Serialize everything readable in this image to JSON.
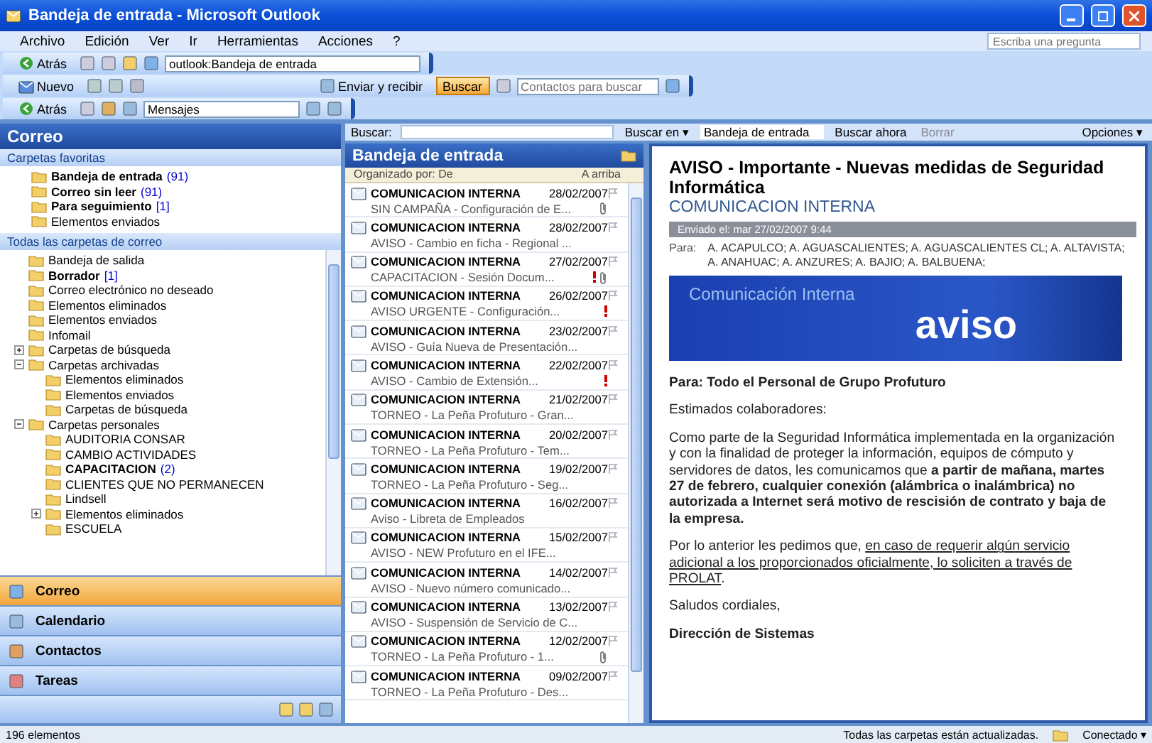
{
  "window": {
    "title": "Bandeja de entrada - Microsoft Outlook"
  },
  "menu": [
    "Archivo",
    "Edición",
    "Ver",
    "Ir",
    "Herramientas",
    "Acciones",
    "?"
  ],
  "help_box": {
    "placeholder": "Escriba una pregunta"
  },
  "toolbar1": {
    "back": "Atrás",
    "address": "outlook:Bandeja de entrada"
  },
  "toolbar2": {
    "new": "Nuevo",
    "send_receive": "Enviar y recibir",
    "find": {
      "label": "Buscar",
      "active": true
    },
    "contacts": {
      "placeholder": "Contactos para buscar"
    }
  },
  "toolbar3": {
    "back": "Atrás",
    "view": "Mensajes"
  },
  "nav": {
    "header": "Correo",
    "favorites_header": "Carpetas favoritas",
    "favorites": [
      {
        "label": "Bandeja de entrada",
        "count": "(91)",
        "unread": true
      },
      {
        "label": "Correo sin leer",
        "count": "(91)",
        "unread": true
      },
      {
        "label": "Para seguimiento",
        "count": "[1]",
        "unread": true
      },
      {
        "label": "Elementos enviados",
        "unread": false
      }
    ],
    "all_header": "Todas las carpetas de correo",
    "tree": [
      {
        "label": "Bandeja de salida",
        "unread": false
      },
      {
        "label": "Borrador",
        "count": "[1]",
        "unread": true
      },
      {
        "label": "Correo electrónico no deseado",
        "unread": false
      },
      {
        "label": "Elementos eliminados",
        "unread": false
      },
      {
        "label": "Elementos enviados",
        "unread": false
      },
      {
        "label": "Infomail",
        "unread": false
      },
      {
        "label": "Carpetas de búsqueda",
        "unread": false,
        "expanded": false
      },
      {
        "label": "Carpetas archivadas",
        "unread": false,
        "expanded": true,
        "children": [
          {
            "label": "Elementos eliminados",
            "unread": false
          },
          {
            "label": "Elementos enviados",
            "unread": false
          },
          {
            "label": "Carpetas de búsqueda",
            "unread": false
          }
        ]
      },
      {
        "label": "Carpetas personales",
        "unread": false,
        "expanded": true,
        "children": [
          {
            "label": "AUDITORIA CONSAR",
            "unread": false
          },
          {
            "label": "CAMBIO ACTIVIDADES",
            "unread": false
          },
          {
            "label": "CAPACITACION",
            "count": "(2)",
            "unread": true
          },
          {
            "label": "CLIENTES QUE NO PERMANECEN",
            "unread": false
          },
          {
            "label": "Lindsell",
            "unread": false
          },
          {
            "label": "Elementos eliminados",
            "unread": false,
            "expanded": false
          },
          {
            "label": "ESCUELA",
            "unread": false
          }
        ]
      }
    ],
    "buttons": [
      {
        "label": "Correo",
        "selected": true
      },
      {
        "label": "Calendario",
        "selected": false
      },
      {
        "label": "Contactos",
        "selected": false
      },
      {
        "label": "Tareas",
        "selected": false
      }
    ]
  },
  "search": {
    "label": "Buscar:",
    "scope_label": "Buscar en ▾",
    "scope": "Bandeja de entrada",
    "find_now": "Buscar ahora",
    "clear": "Borrar",
    "options": "Opciones ▾"
  },
  "list": {
    "title": "Bandeja de entrada",
    "sort": "Organizado por: De",
    "order": "A arriba",
    "messages": [
      {
        "sender": "COMUNICACION INTERNA",
        "date": "28/02/2007",
        "subject": "SIN CAMPAÑA - Configuración de E...",
        "important": false,
        "attachment": true
      },
      {
        "sender": "COMUNICACION INTERNA",
        "date": "28/02/2007",
        "subject": "AVISO - Cambio en ficha - Regional ...",
        "important": false,
        "attachment": false
      },
      {
        "sender": "COMUNICACION INTERNA",
        "date": "27/02/2007",
        "subject": "CAPACITACION - Sesión Docum...",
        "important": true,
        "attachment": true
      },
      {
        "sender": "COMUNICACION INTERNA",
        "date": "26/02/2007",
        "subject": "AVISO URGENTE - Configuración...",
        "important": true,
        "attachment": false
      },
      {
        "sender": "COMUNICACION INTERNA",
        "date": "23/02/2007",
        "subject": "AVISO - Guía Nueva de Presentación...",
        "important": false,
        "attachment": false
      },
      {
        "sender": "COMUNICACION INTERNA",
        "date": "22/02/2007",
        "subject": "AVISO - Cambio de Extensión...",
        "important": true,
        "attachment": false
      },
      {
        "sender": "COMUNICACION INTERNA",
        "date": "21/02/2007",
        "subject": "TORNEO - La Peña Profuturo - Gran...",
        "important": false,
        "attachment": false
      },
      {
        "sender": "COMUNICACION INTERNA",
        "date": "20/02/2007",
        "subject": "TORNEO - La Peña Profuturo - Tem...",
        "important": false,
        "attachment": false
      },
      {
        "sender": "COMUNICACION INTERNA",
        "date": "19/02/2007",
        "subject": "TORNEO - La Peña Profuturo - Seg...",
        "important": false,
        "attachment": false
      },
      {
        "sender": "COMUNICACION INTERNA",
        "date": "16/02/2007",
        "subject": "Aviso - Libreta de Empleados",
        "important": false,
        "attachment": false
      },
      {
        "sender": "COMUNICACION INTERNA",
        "date": "15/02/2007",
        "subject": "AVISO - NEW Profuturo en el IFE...",
        "important": false,
        "attachment": false
      },
      {
        "sender": "COMUNICACION INTERNA",
        "date": "14/02/2007",
        "subject": "AVISO - Nuevo número comunicado...",
        "important": false,
        "attachment": false
      },
      {
        "sender": "COMUNICACION INTERNA",
        "date": "13/02/2007",
        "subject": "AVISO - Suspensión de Servicio de C...",
        "important": false,
        "attachment": false
      },
      {
        "sender": "COMUNICACION INTERNA",
        "date": "12/02/2007",
        "subject": "TORNEO - La Peña Profuturo - 1...",
        "important": false,
        "attachment": true
      },
      {
        "sender": "COMUNICACION INTERNA",
        "date": "09/02/2007",
        "subject": "TORNEO - La Peña Profuturo - Des...",
        "important": false,
        "attachment": false
      }
    ]
  },
  "reading": {
    "subject": "AVISO - Importante - Nuevas medidas de Seguridad Informática",
    "from": "COMUNICACION INTERNA",
    "info": "Enviado el: mar 27/02/2007 9:44",
    "to_label": "Para:",
    "to": "A. ACAPULCO; A. AGUASCALIENTES; A. AGUASCALIENTES CL; A. ALTAVISTA; A. ANAHUAC; A. ANZURES; A. BAJIO; A. BALBUENA;",
    "banner": {
      "caption": "Comunicación Interna",
      "word": "aviso"
    },
    "body": [
      {
        "kind": "heading",
        "text": "Para:   Todo el Personal de Grupo Profuturo"
      },
      {
        "kind": "text",
        "text": "Estimados colaboradores:"
      },
      {
        "kind": "text",
        "text": "Como parte de la Seguridad Informática implementada en la organización y con la finalidad de proteger la información, equipos de cómputo y servidores de datos, les comunicamos que **a partir de mañana, martes 27 de febrero, cualquier conexión (alámbrica o inalámbrica) no autorizada a Internet será motivo de rescisión de contrato y baja de la empresa.**"
      },
      {
        "kind": "underlined",
        "text": "Por lo anterior les pedimos que, ",
        "underlined": "en caso de requerir algún servicio adicional a los proporcionados oficialmente, lo soliciten a través de PROLAT",
        "tail": "."
      },
      {
        "kind": "text",
        "text": "Saludos cordiales,"
      },
      {
        "kind": "heading",
        "text": "Dirección de Sistemas"
      }
    ]
  },
  "status": {
    "count": "196 elementos",
    "sync": "Todas las carpetas están actualizadas.",
    "connection": "Conectado ▾"
  }
}
